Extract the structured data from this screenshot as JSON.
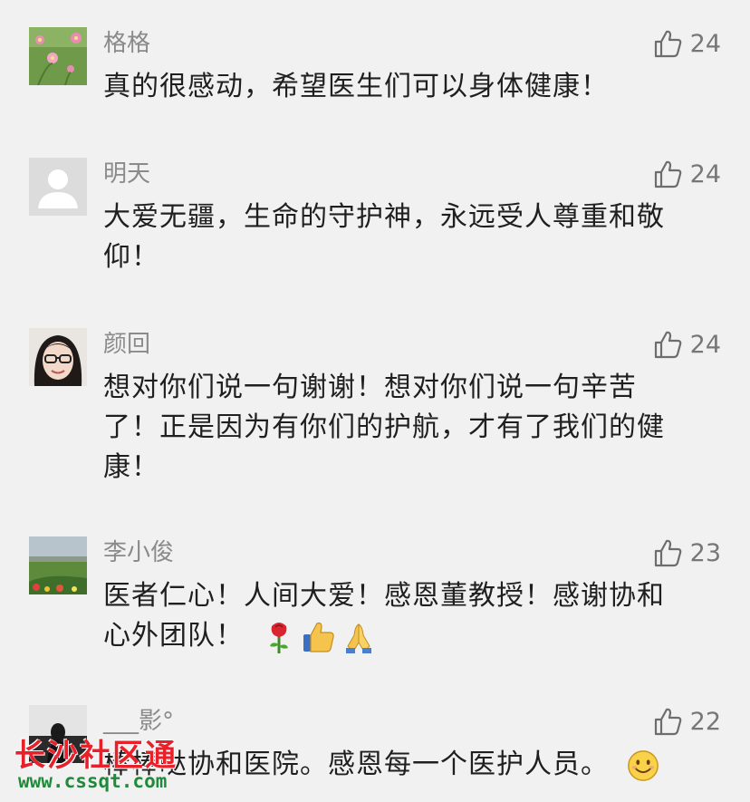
{
  "comments": [
    {
      "username": "格格",
      "likes": "24",
      "text_lines": [
        "真的很感动，希望医生们可以身体健康！"
      ],
      "avatar": "pink-flowers-avatar"
    },
    {
      "username": "明天",
      "likes": "24",
      "text_lines": [
        "大爱无疆，生命的守护神，永远受人尊重和敬",
        "仰！"
      ],
      "avatar": "default-user-avatar"
    },
    {
      "username": "颜回",
      "likes": "24",
      "text_lines": [
        "想对你们说一句谢谢！想对你们说一句辛苦",
        "了！正是因为有你们的护航，才有了我们的健",
        "康！"
      ],
      "avatar": "woman-glasses-avatar"
    },
    {
      "username": "李小俊",
      "likes": "23",
      "text_lines": [
        "医者仁心！人间大爱！感恩董教授！感谢协和",
        "心外团队！"
      ],
      "emojis": [
        "rose-emoji",
        "thumbs-up-emoji",
        "praying-hands-emoji"
      ],
      "avatar": "landscape-avatar"
    },
    {
      "username": "___影°",
      "likes": "22",
      "text_lines": [
        "棒棒哒协和医院。感恩每一个医护人员。"
      ],
      "emojis": [
        "smile-emoji"
      ],
      "avatar": "dark-figure-avatar"
    }
  ],
  "like_icon": "thumbs-up-outline-icon",
  "watermark": {
    "name": "长沙社区通",
    "url": "www.cssqt.com"
  },
  "colors": {
    "background": "#f1f1f1",
    "username": "#8a8a8a",
    "text": "#1f1f1f",
    "watermark_red": "#e8202a",
    "watermark_green": "#1f8a3a"
  }
}
